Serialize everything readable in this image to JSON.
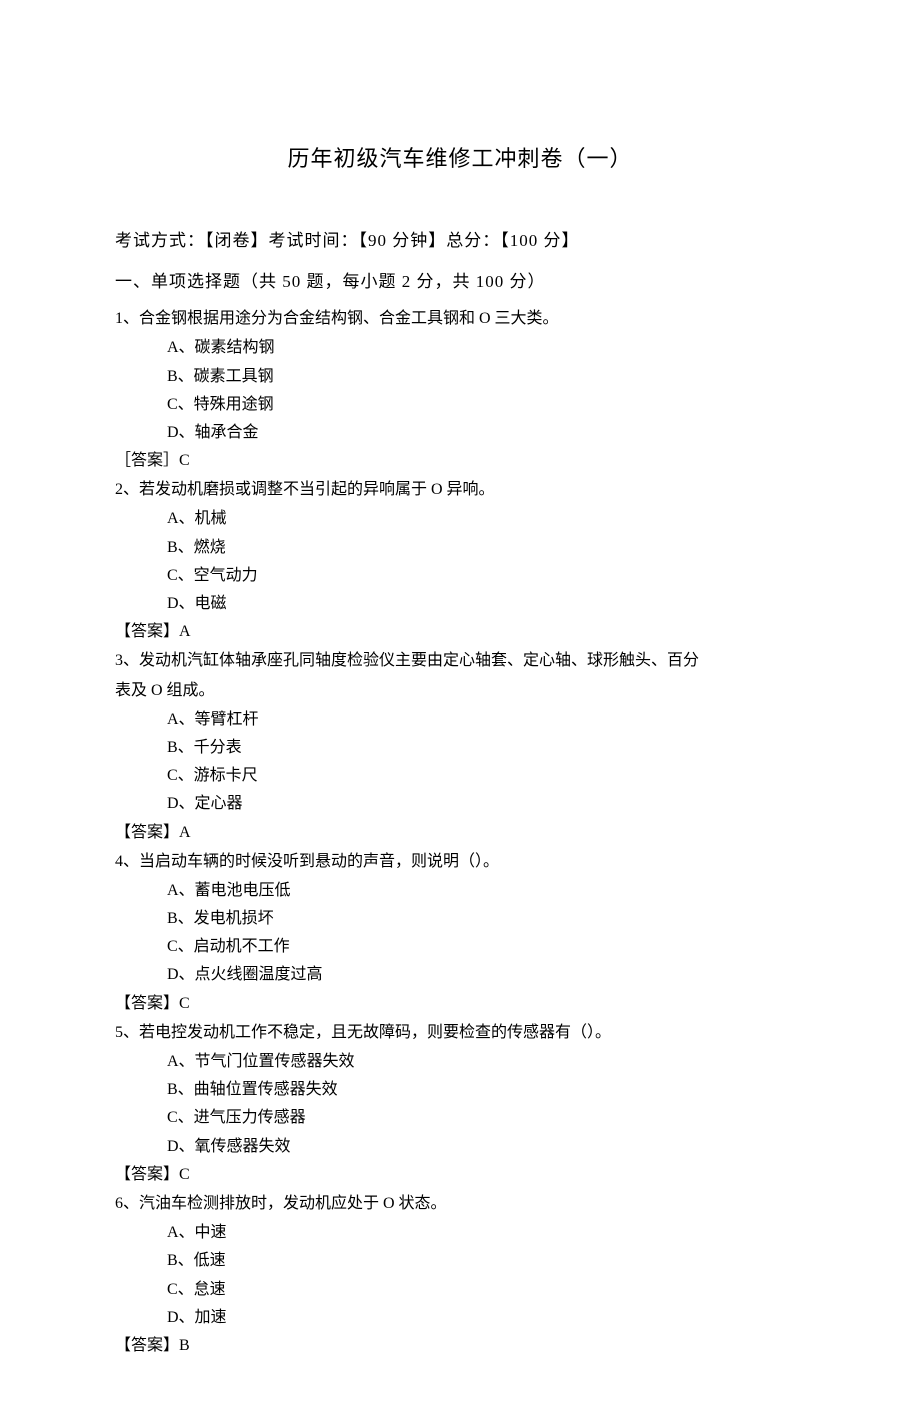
{
  "title": "历年初级汽车维修工冲刺卷（一）",
  "exam_info": "考试方式：【闭卷】考试时间：【90 分钟】总分：【100 分】",
  "section_header": "一、单项选择题（共 50 题，每小题 2 分，共 100 分）",
  "questions": [
    {
      "num": "1",
      "stem": "1、合金钢根据用途分为合金结构钢、合金工具钢和 O 三大类。",
      "options": [
        "A、碳素结构钢",
        "B、碳素工具钢",
        "C、特殊用途钢",
        "D、轴承合金"
      ],
      "answer": "［答案］C"
    },
    {
      "num": "2",
      "stem": "2、若发动机磨损或调整不当引起的异响属于 O 异响。",
      "options": [
        "A、机械",
        "B、燃烧",
        "C、空气动力",
        "D、电磁"
      ],
      "answer": "【答案】A"
    },
    {
      "num": "3",
      "stem": "3、发动机汽缸体轴承座孔同轴度检验仪主要由定心轴套、定心轴、球形触头、百分",
      "stem2": "表及 O 组成。",
      "options": [
        "A、等臂杠杆",
        "B、千分表",
        "C、游标卡尺",
        "D、定心器"
      ],
      "answer": "【答案】A"
    },
    {
      "num": "4",
      "stem": "4、当启动车辆的时候没听到悬动的声音，则说明（）。",
      "options": [
        "A、蓄电池电压低",
        "B、发电机损坏",
        "C、启动机不工作",
        "D、点火线圈温度过高"
      ],
      "answer": "【答案】C"
    },
    {
      "num": "5",
      "stem": "5、若电控发动机工作不稳定，且无故障码，则要检查的传感器有（）。",
      "options": [
        "A、节气门位置传感器失效",
        "B、曲轴位置传感器失效",
        "C、进气压力传感器",
        "D、氧传感器失效"
      ],
      "answer": "【答案】C"
    },
    {
      "num": "6",
      "stem": "6、汽油车检测排放时，发动机应处于 O 状态。",
      "options": [
        "A、中速",
        "B、低速",
        "C、怠速",
        "D、加速"
      ],
      "answer": "【答案】B"
    }
  ]
}
